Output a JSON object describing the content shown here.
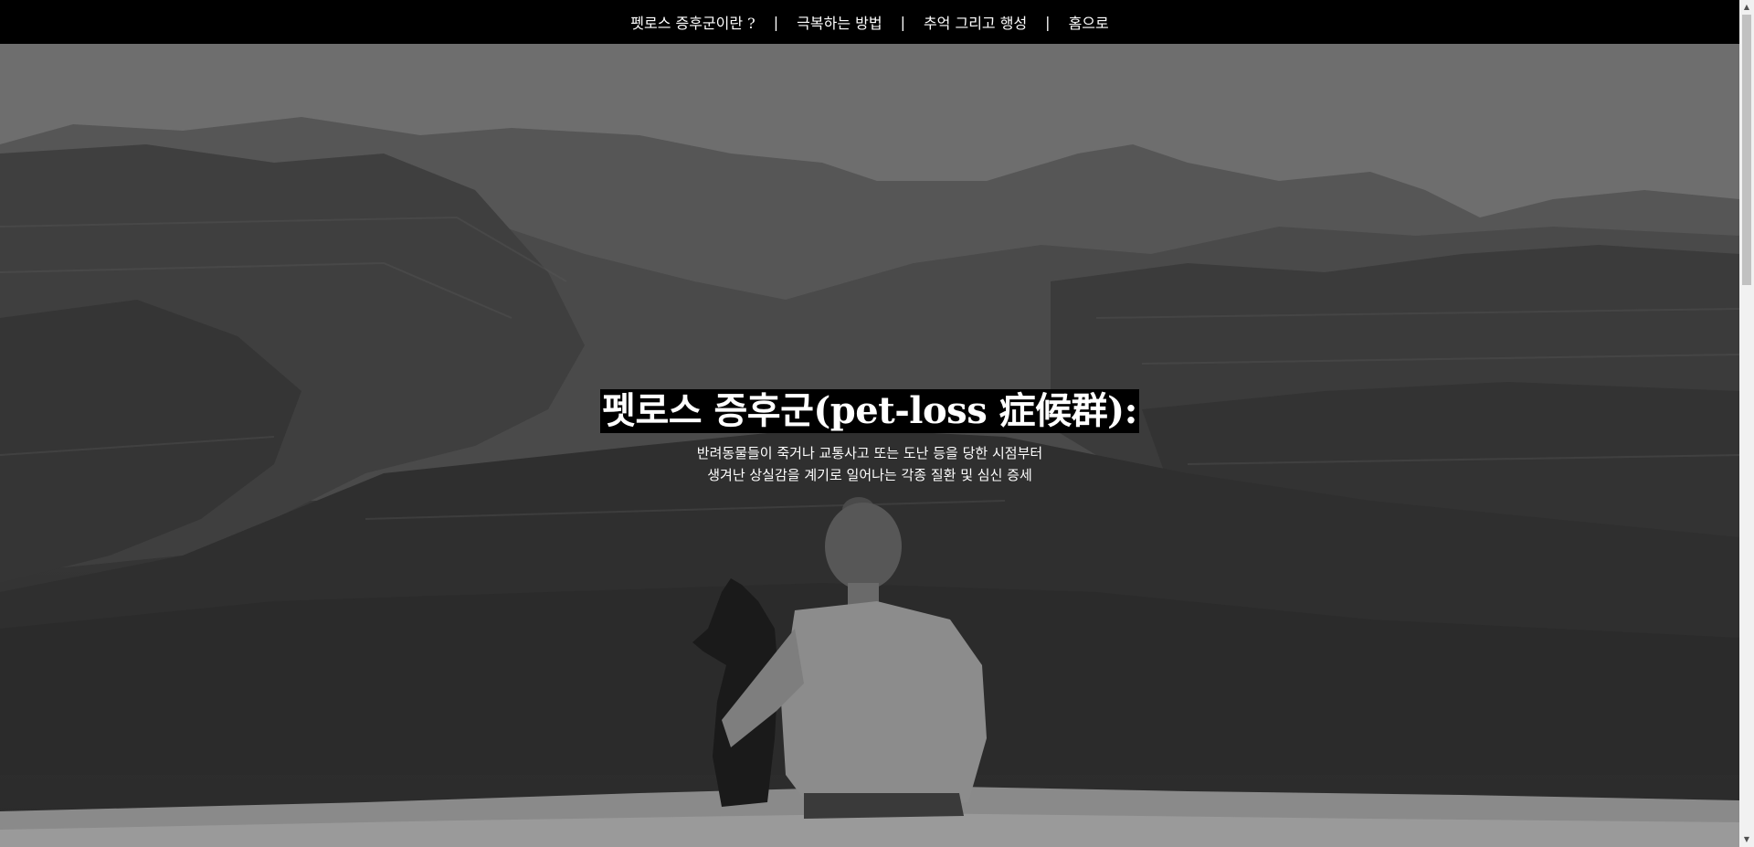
{
  "nav": {
    "items": [
      {
        "label": "펫로스 증후군이란 ?"
      },
      {
        "label": "극복하는 방법"
      },
      {
        "label": "추억 그리고 행성"
      },
      {
        "label": "홈으로"
      }
    ],
    "separator": "|"
  },
  "hero": {
    "title": "펫로스 증후군(pet-loss 症候群):",
    "subtitle_line1": "반려동물들이 죽거나 교통사고 또는 도난 등을 당한 시점부터",
    "subtitle_line2": "생겨난 상실감을 계기로 일어나는 각종 질환 및 심신 증세",
    "image_description_icon": "canyon-person-dog-photo"
  },
  "colors": {
    "nav_bg": "#000000",
    "nav_text": "#ffffff",
    "headline_bg": "#000000"
  },
  "scrollbar": {
    "up_icon": "triangle-up-icon",
    "down_icon": "triangle-down-icon"
  }
}
